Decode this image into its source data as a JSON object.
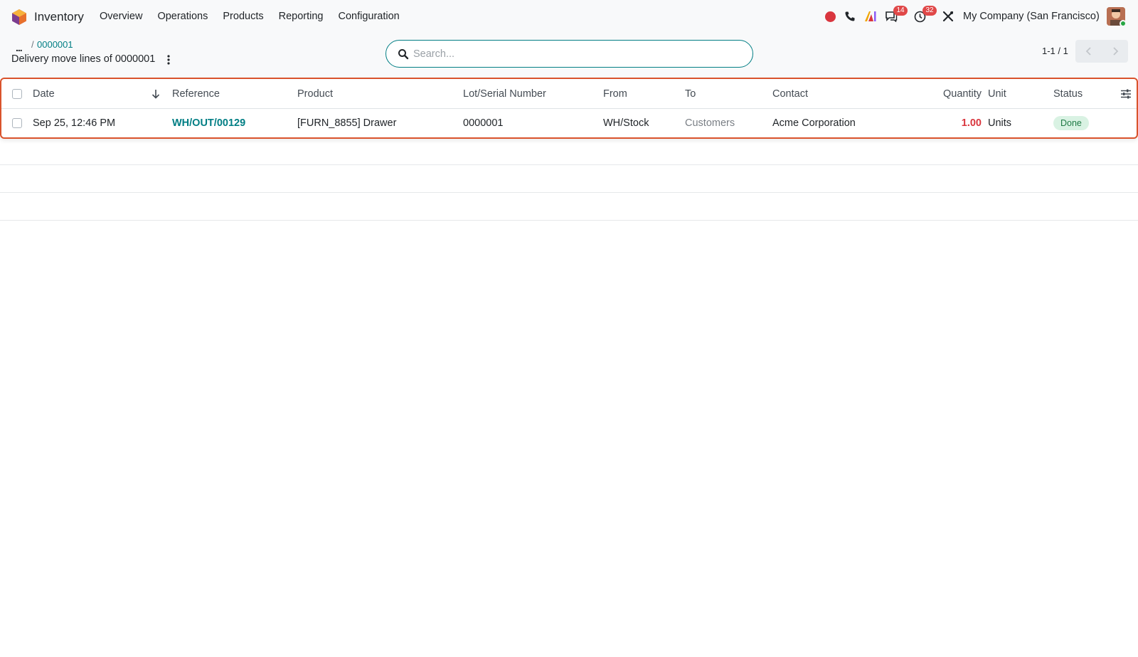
{
  "navbar": {
    "app_name": "Inventory",
    "menu": [
      "Overview",
      "Operations",
      "Products",
      "Reporting",
      "Configuration"
    ],
    "systray": {
      "messages_count": "14",
      "activities_count": "32",
      "company": "My Company (San Francisco)"
    }
  },
  "control_panel": {
    "breadcrumb_ellipsis": "...",
    "breadcrumb_separator": "/",
    "breadcrumb_link": "0000001",
    "view_title": "Delivery move lines of 0000001",
    "search_placeholder": "Search...",
    "pager": "1-1 / 1"
  },
  "table": {
    "columns": [
      "Date",
      "Reference",
      "Product",
      "Lot/Serial Number",
      "From",
      "To",
      "Contact",
      "Quantity",
      "Unit",
      "Status"
    ],
    "rows": [
      {
        "date": "Sep 25, 12:46 PM",
        "reference": "WH/OUT/00129",
        "product": "[FURN_8855] Drawer",
        "lot": "0000001",
        "from": "WH/Stock",
        "to": "Customers",
        "contact": "Acme Corporation",
        "quantity": "1.00",
        "unit": "Units",
        "status": "Done"
      }
    ]
  },
  "colors": {
    "accent": "#017e84",
    "highlight_border": "#d9532c",
    "quantity_red": "#d9363e",
    "status_bg": "#d9f2e3"
  }
}
